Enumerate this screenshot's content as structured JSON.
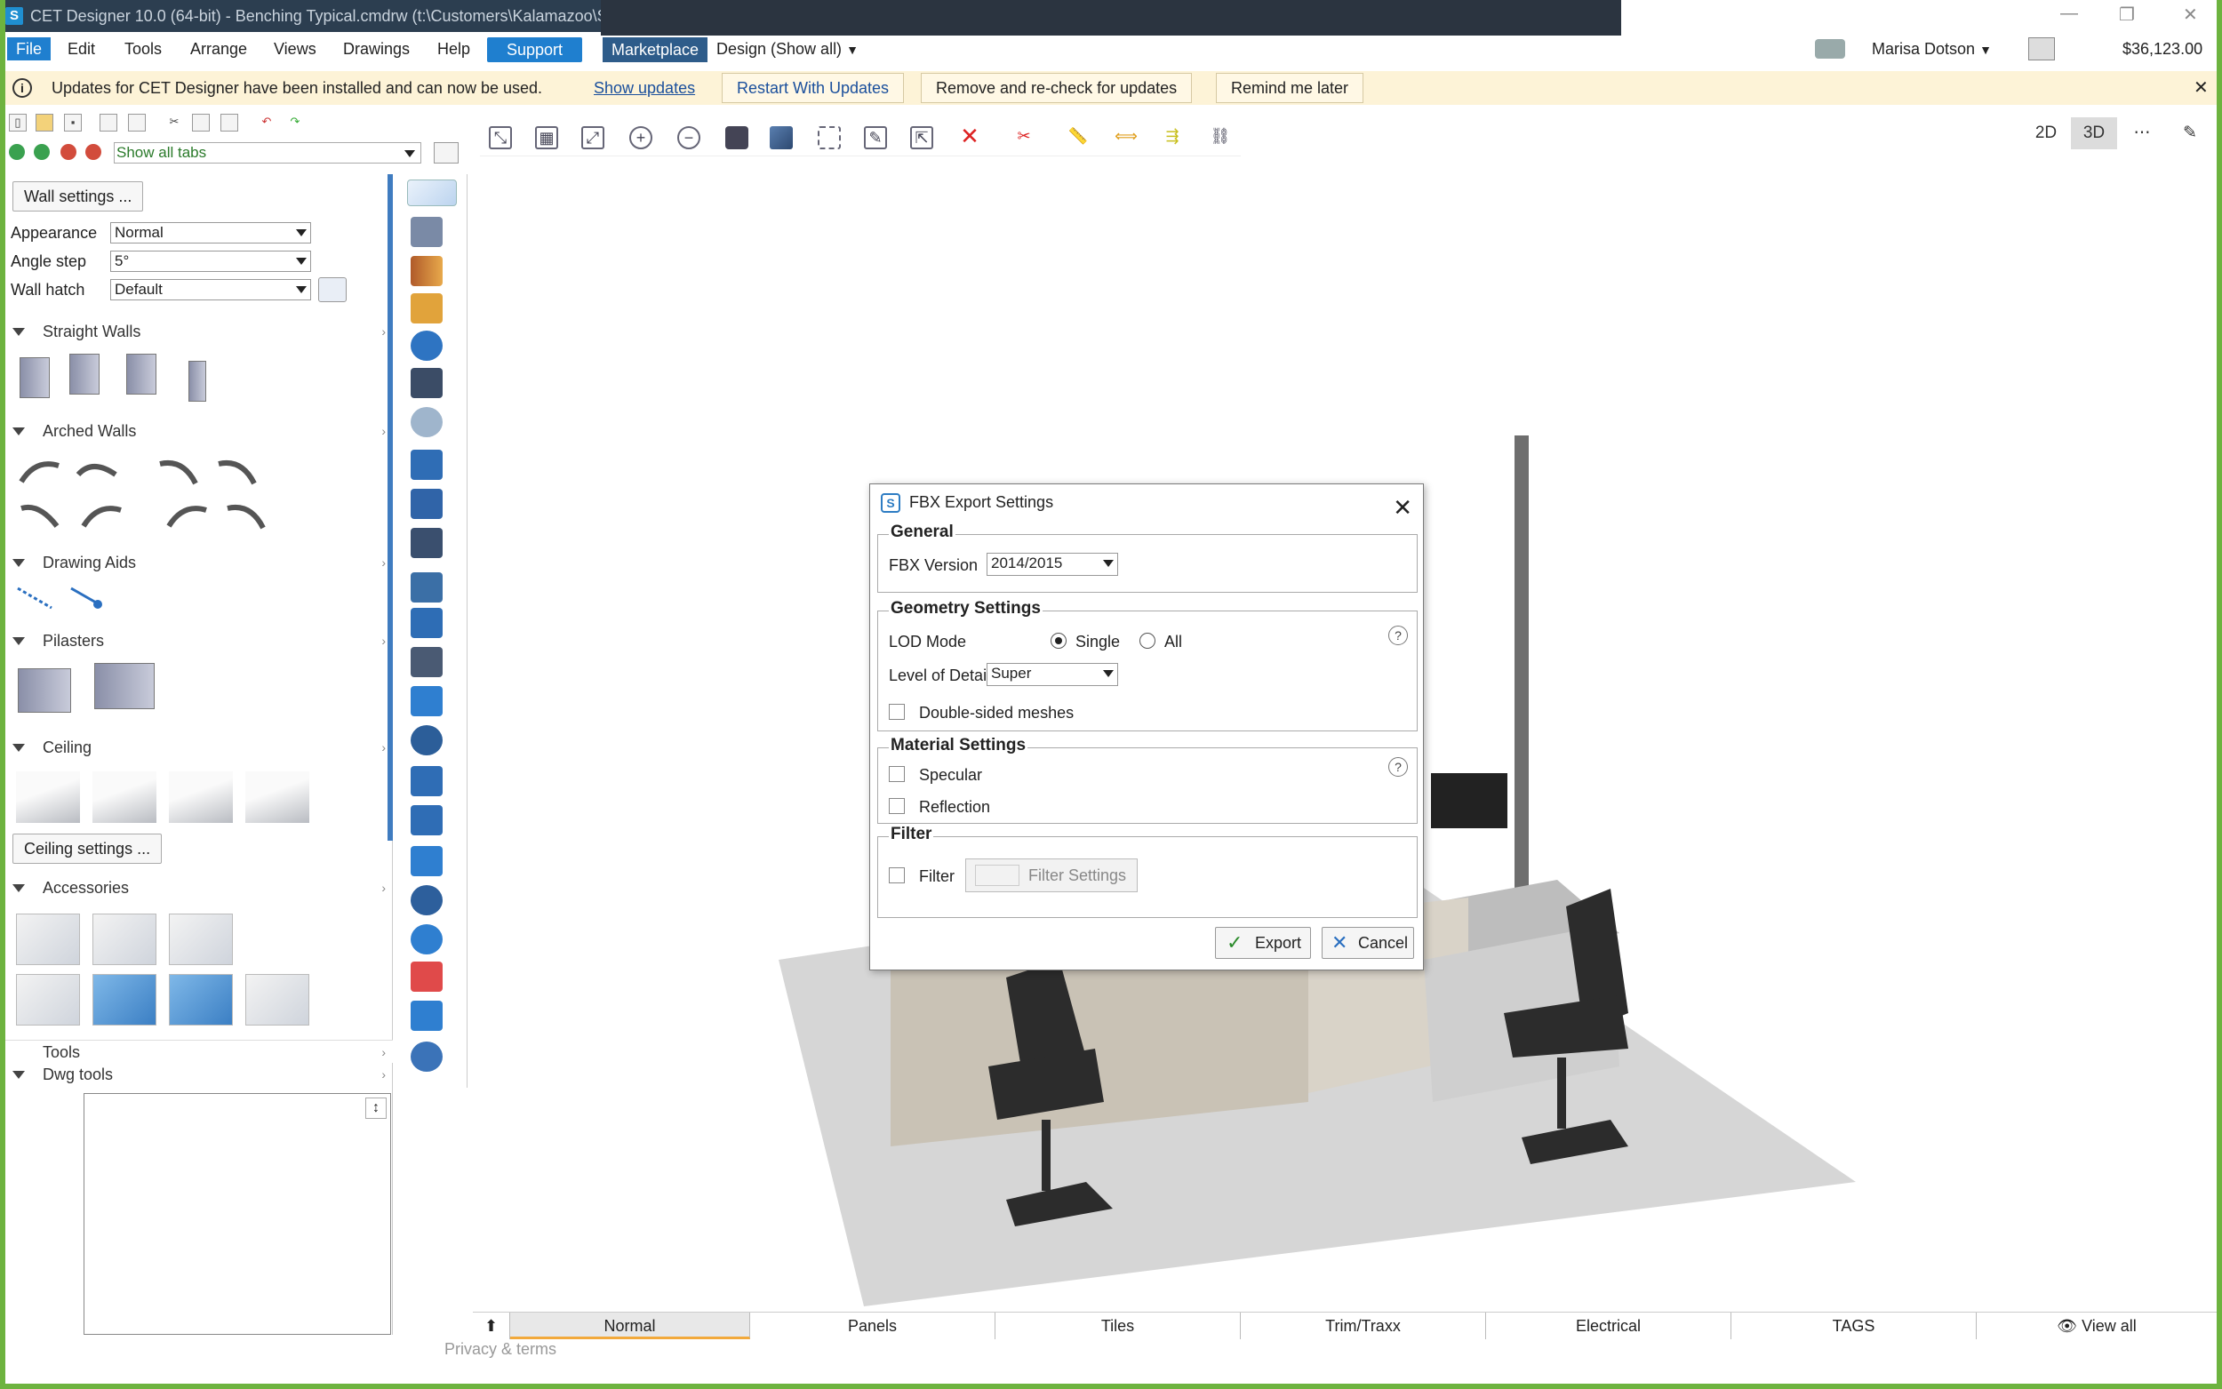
{
  "window": {
    "title": "CET Designer 10.0 (64-bit) - Benching Typical.cmdrw (t:\\Customers\\Kalamazoo\\S",
    "app_icon": "S",
    "controls": [
      "—",
      "❐",
      "✕"
    ]
  },
  "menubar": {
    "items": [
      "File",
      "Edit",
      "Tools",
      "Arrange",
      "Views",
      "Drawings",
      "Help"
    ],
    "support": "Support",
    "marketplace": "Marketplace",
    "design_mode": "Design (Show all)",
    "user": "Marisa Dotson",
    "balance": "$36,123.00"
  },
  "updates": {
    "message": "Updates for CET Designer have been installed and can now be used.",
    "show_updates": "Show updates",
    "restart": "Restart With Updates",
    "remove": "Remove and re-check for updates",
    "remind": "Remind me later"
  },
  "tabs_select": "Show all tabs",
  "left_panel": {
    "wall_settings": "Wall settings ...",
    "appearance_label": "Appearance",
    "appearance_value": "Normal",
    "angle_label": "Angle step",
    "angle_value": "5°",
    "hatch_label": "Wall hatch",
    "hatch_value": "Default",
    "sections": {
      "straight": "Straight Walls",
      "arched": "Arched Walls",
      "aids": "Drawing Aids",
      "pilasters": "Pilasters",
      "ceiling": "Ceiling",
      "accessories": "Accessories",
      "tools": "Tools",
      "dwg": "Dwg tools"
    },
    "ceiling_settings": "Ceiling settings ..."
  },
  "view_buttons": {
    "b2d": "2D",
    "b3d": "3D"
  },
  "dialog": {
    "title": "FBX Export Settings",
    "general": "General",
    "fbx_version_label": "FBX Version",
    "fbx_version_value": "2014/2015",
    "geometry": "Geometry Settings",
    "lod_label": "LOD Mode",
    "lod_single": "Single",
    "lod_all": "All",
    "lod_selected": "Single",
    "detail_label": "Level of Detail",
    "detail_value": "Super",
    "double_sided": "Double-sided meshes",
    "material": "Material Settings",
    "specular": "Specular",
    "reflection": "Reflection",
    "filter_group": "Filter",
    "filter_check": "Filter",
    "filter_settings": "Filter Settings",
    "export": "Export",
    "cancel": "Cancel",
    "help": "?"
  },
  "bottom_tabs": [
    "Normal",
    "Panels",
    "Tiles",
    "Trim/Traxx",
    "Electrical",
    "TAGS"
  ],
  "view_all": "View all",
  "privacy": "Privacy & terms",
  "colors": {
    "accent": "#1f7fcf",
    "frame": "#6db33f",
    "update_bar": "#fdf3d7",
    "floor": "#d6d6d6"
  }
}
